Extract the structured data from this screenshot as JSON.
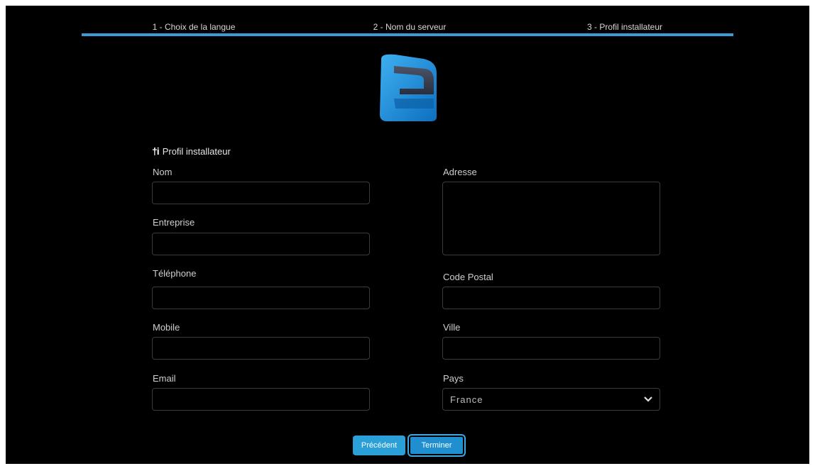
{
  "steps": [
    {
      "label": "1 - Choix de la langue"
    },
    {
      "label": "2 - Nom du serveur"
    },
    {
      "label": "3 - Profil installateur"
    }
  ],
  "section": {
    "icon": "person-info-icon",
    "title": "Profil installateur"
  },
  "form": {
    "nom": {
      "label": "Nom",
      "value": ""
    },
    "entreprise": {
      "label": "Entreprise",
      "value": ""
    },
    "telephone": {
      "label": "Téléphone",
      "value": ""
    },
    "mobile": {
      "label": "Mobile",
      "value": ""
    },
    "email": {
      "label": "Email",
      "value": ""
    },
    "adresse": {
      "label": "Adresse",
      "value": ""
    },
    "code_postal": {
      "label": "Code Postal",
      "value": ""
    },
    "ville": {
      "label": "Ville",
      "value": ""
    },
    "pays": {
      "label": "Pays",
      "value": "France"
    }
  },
  "buttons": {
    "previous": "Précédent",
    "finish": "Terminer"
  },
  "colors": {
    "accent": "#3a9bd6",
    "background": "#000000"
  }
}
